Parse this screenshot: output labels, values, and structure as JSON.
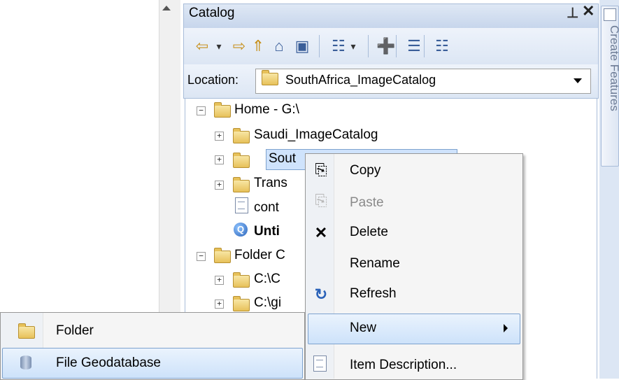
{
  "catalog": {
    "title": "Catalog",
    "pin_glyph": "↑",
    "close_glyph": "✕",
    "toolbar": [
      {
        "name": "back-icon",
        "glyph": "⇦"
      },
      {
        "name": "back-dropdown-icon",
        "glyph": "▾"
      },
      {
        "name": "forward-icon",
        "glyph": "⇨"
      },
      {
        "name": "up-one-level-icon",
        "glyph": "⇑"
      },
      {
        "name": "home-icon",
        "glyph": "⌂"
      },
      {
        "name": "connect-folder-icon",
        "glyph": "▣"
      },
      {
        "name": "views-icon",
        "glyph": "☷"
      },
      {
        "name": "views-dropdown-icon",
        "glyph": "▾"
      },
      {
        "name": "connect-to-folder-icon",
        "glyph": "➕"
      },
      {
        "name": "toggle-contents-panel-icon",
        "glyph": "☰"
      },
      {
        "name": "options-icon",
        "glyph": "☷"
      }
    ],
    "location_label": "Location:",
    "location_value": "SouthAfrica_ImageCatalog"
  },
  "side_tab": {
    "label": "Create Features"
  },
  "tree": {
    "home": {
      "expander": "−",
      "label": "Home - G:\\"
    },
    "saudi": {
      "expander": "+",
      "label": "Saudi_ImageCatalog"
    },
    "south": {
      "expander": "+",
      "label": "Sout"
    },
    "trans": {
      "expander": "+",
      "label": "Trans"
    },
    "conte": {
      "label": "cont"
    },
    "untitled": {
      "label": "Unti"
    },
    "folder_connections": {
      "expander": "−",
      "label": "Folder C"
    },
    "c_c": {
      "expander": "+",
      "label": "C:\\C"
    },
    "c_gi": {
      "expander": "+",
      "label": "C:\\gi"
    }
  },
  "context_menu": {
    "items": [
      {
        "label": "Copy",
        "icon": "copy-icon",
        "glyph": "⎘"
      },
      {
        "label": "Paste",
        "icon": "paste-icon",
        "glyph": "⎘"
      },
      {
        "label": "Delete",
        "icon": "delete-icon",
        "glyph": "✖"
      },
      {
        "label": "Rename",
        "icon": "",
        "glyph": ""
      },
      {
        "label": "Refresh",
        "icon": "refresh-icon",
        "glyph": "↻"
      },
      {
        "label": "New",
        "icon": "",
        "glyph": ""
      },
      {
        "label": "Item Description...",
        "icon": "item-description-icon",
        "glyph": "☷"
      }
    ]
  },
  "submenu": {
    "items": [
      {
        "label": "Folder",
        "icon": "folder-icon"
      },
      {
        "label": "File Geodatabase",
        "icon": "file-geodatabase-icon"
      }
    ]
  }
}
